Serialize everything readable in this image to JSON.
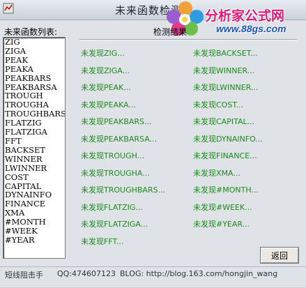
{
  "window": {
    "title": "未来函数检测"
  },
  "watermark": {
    "name": "分析家公式网",
    "url": "www.88gs.com",
    "colors": {
      "name": "#e0187a",
      "url": "#1a4fbf"
    }
  },
  "list": {
    "label": "未来函数列表:",
    "items": [
      "ZIG",
      "ZIGA",
      "PEAK",
      "PEAKA",
      "PEAKBARS",
      "PEAKBARSA",
      "TROUGH",
      "TROUGHA",
      "TROUGHBARS",
      "FLATZIG",
      "FLATZIGA",
      "FFT",
      "BACKSET",
      "WINNER",
      "LWINNER",
      "COST",
      "CAPITAL",
      "DYNAINFO",
      "FINANCE",
      "XMA",
      "#MONTH",
      "#WEEK",
      "#YEAR"
    ]
  },
  "results": {
    "title": "检测结果",
    "left": [
      "未发现ZIG...",
      "未发现ZIGA...",
      "未发现PEAK...",
      "未发现PEAKA...",
      "未发现PEAKBARS...",
      "未发现PEAKBARSA...",
      "未发现TROUGH...",
      "未发现TROUGHA...",
      "未发现TROUGHBARS...",
      "未发现FLATZIG...",
      "未发现FLATZIGA...",
      "未发现FFT..."
    ],
    "right": [
      "未发现BACKSET...",
      "未发现WINNER...",
      "未发现LWINNER...",
      "未发现COST...",
      "未发现CAPITAL...",
      "未发现DYNAINFO...",
      "未发现FINANCE...",
      "未发现XMA...",
      "未发现#MONTH...",
      "未发现#WEEK...",
      "未发现#YEAR..."
    ],
    "color": "#1b8a1b"
  },
  "buttons": {
    "back": "返回"
  },
  "status": {
    "author": "短线阻击手",
    "qq": "QQ:474607123",
    "blog": "BLOG: http://blog.163.com/hongjin_wang"
  }
}
